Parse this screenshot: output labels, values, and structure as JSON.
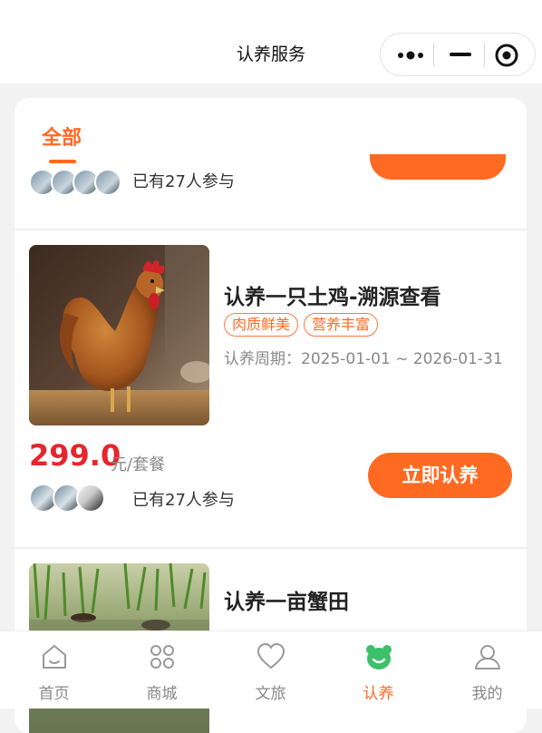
{
  "header": {
    "title": "认养服务"
  },
  "capsule": {
    "more_icon": "more-dots-icon",
    "minimize_icon": "minimize-icon",
    "close_icon": "target-close-icon"
  },
  "tabs": [
    {
      "label": "全部",
      "active": true
    }
  ],
  "partial_item": {
    "joined_text": "已有27人参与"
  },
  "products": [
    {
      "title": "认养一只土鸡-溯源查看",
      "tags": [
        "肉质鲜美",
        "营养丰富"
      ],
      "period": "认养周期：2025-01-01 ~ 2026-01-31",
      "price": "299.0",
      "unit": "元/套餐",
      "joined_text": "已有27人参与",
      "button_label": "立即认养",
      "image_icon": "rooster-image"
    },
    {
      "title": "认养一亩蟹田",
      "image_icon": "crab-paddy-image"
    }
  ],
  "tabbar": {
    "items": [
      {
        "label": "首页",
        "icon": "home-icon",
        "active": false
      },
      {
        "label": "商城",
        "icon": "grid-icon",
        "active": false
      },
      {
        "label": "文旅",
        "icon": "heart-icon",
        "active": false
      },
      {
        "label": "认养",
        "icon": "bear-icon",
        "active": true
      },
      {
        "label": "我的",
        "icon": "user-icon",
        "active": false
      }
    ]
  },
  "colors": {
    "accent": "#ff6a23",
    "price": "#e5262c",
    "tab_active_icon": "#3cc06b"
  }
}
